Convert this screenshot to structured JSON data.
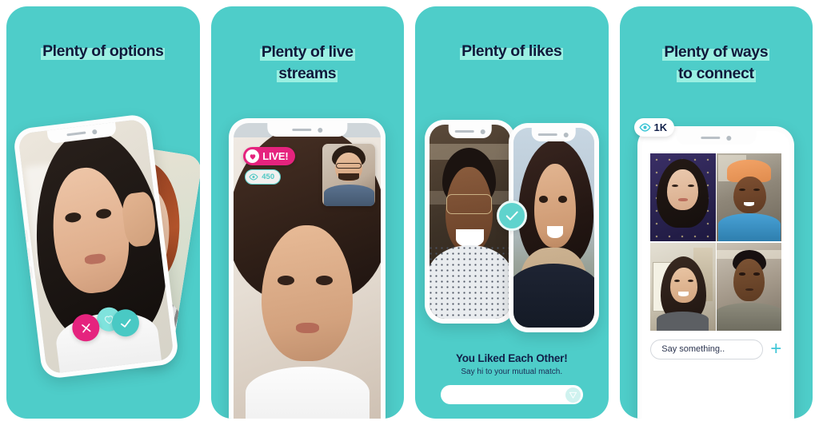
{
  "app": {
    "brand_bg": "#4ecdc9",
    "highlight": "#a0f3e4",
    "title_color": "#101a3c",
    "accent_pink": "#e5237e",
    "accent_teal": "#49c9c4"
  },
  "panels": [
    {
      "id": "plenty-of-options",
      "title": "Plenty of options",
      "actions": {
        "reject_icon": "x-icon",
        "accept_icon": "check-icon",
        "super_like_icon": "heart-icon"
      }
    },
    {
      "id": "plenty-of-live-streams",
      "title_line1": "Plenty of live",
      "title_line2": "streams",
      "live_badge": {
        "label": "LIVE!",
        "icon": "heart-icon"
      },
      "viewers_badge": {
        "count": "450",
        "icon": "eye-icon"
      }
    },
    {
      "id": "plenty-of-likes",
      "title": "Plenty of likes",
      "match_icon": "check-icon",
      "match_heading": "You Liked Each Other!",
      "match_subtitle": "Say hi to your mutual match.",
      "message_input": {
        "value": "",
        "placeholder": "",
        "send_icon": "send-icon"
      }
    },
    {
      "id": "plenty-of-ways-to-connect",
      "title_line1": "Plenty of ways",
      "title_line2": "to connect",
      "viewers_badge": {
        "count": "1K",
        "icon": "eye-icon"
      },
      "participants": 4,
      "chat": {
        "input_value": "Say something..",
        "input_placeholder": "Say something..",
        "add_icon": "plus-icon"
      }
    }
  ]
}
